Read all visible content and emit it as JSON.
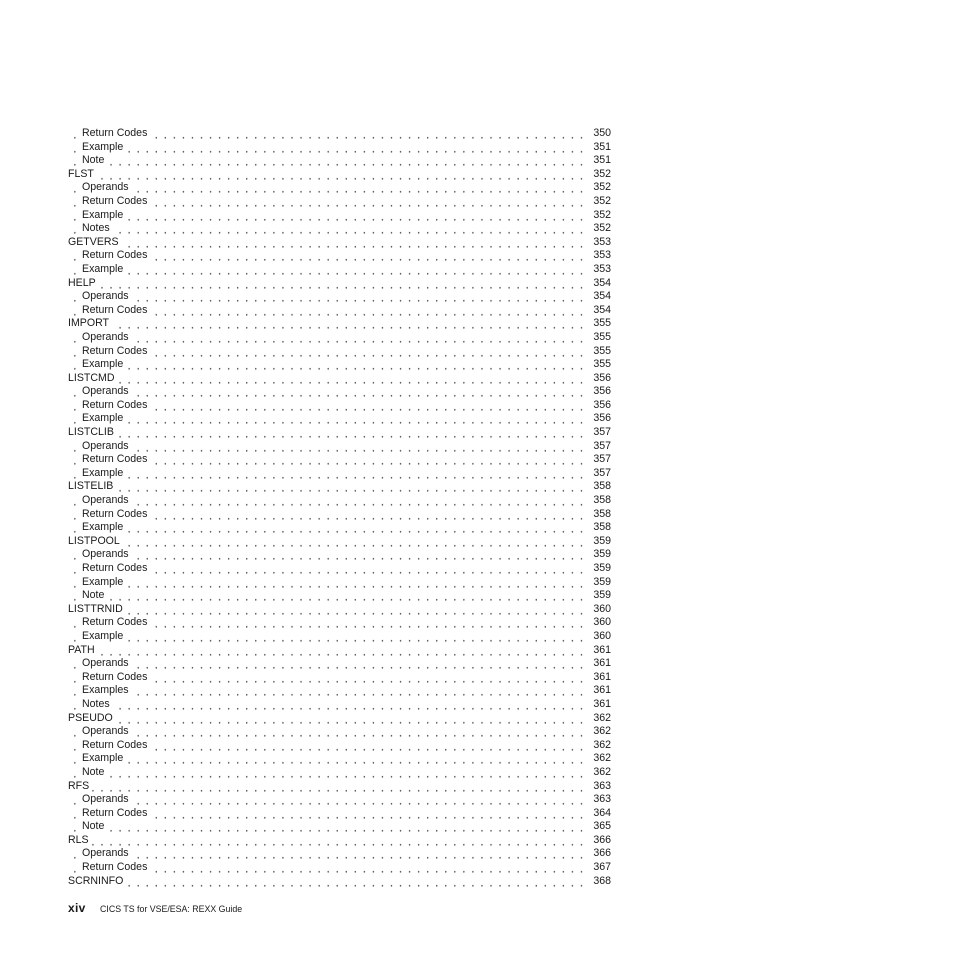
{
  "toc": {
    "entries": [
      {
        "title": "Return Codes",
        "level": 2,
        "page": "350"
      },
      {
        "title": "Example",
        "level": 2,
        "page": "351"
      },
      {
        "title": "Note",
        "level": 2,
        "page": "351"
      },
      {
        "title": "FLST",
        "level": 1,
        "page": "352"
      },
      {
        "title": "Operands",
        "level": 2,
        "page": "352"
      },
      {
        "title": "Return Codes",
        "level": 2,
        "page": "352"
      },
      {
        "title": "Example",
        "level": 2,
        "page": "352"
      },
      {
        "title": "Notes",
        "level": 2,
        "page": "352"
      },
      {
        "title": "GETVERS",
        "level": 1,
        "page": "353"
      },
      {
        "title": "Return Codes",
        "level": 2,
        "page": "353"
      },
      {
        "title": "Example",
        "level": 2,
        "page": "353"
      },
      {
        "title": "HELP",
        "level": 1,
        "page": "354"
      },
      {
        "title": "Operands",
        "level": 2,
        "page": "354"
      },
      {
        "title": "Return Codes",
        "level": 2,
        "page": "354"
      },
      {
        "title": "IMPORT",
        "level": 1,
        "page": "355"
      },
      {
        "title": "Operands",
        "level": 2,
        "page": "355"
      },
      {
        "title": "Return Codes",
        "level": 2,
        "page": "355"
      },
      {
        "title": "Example",
        "level": 2,
        "page": "355"
      },
      {
        "title": "LISTCMD",
        "level": 1,
        "page": "356"
      },
      {
        "title": "Operands",
        "level": 2,
        "page": "356"
      },
      {
        "title": "Return Codes",
        "level": 2,
        "page": "356"
      },
      {
        "title": "Example",
        "level": 2,
        "page": "356"
      },
      {
        "title": "LISTCLIB",
        "level": 1,
        "page": "357"
      },
      {
        "title": "Operands",
        "level": 2,
        "page": "357"
      },
      {
        "title": "Return Codes",
        "level": 2,
        "page": "357"
      },
      {
        "title": "Example",
        "level": 2,
        "page": "357"
      },
      {
        "title": "LISTELIB",
        "level": 1,
        "page": "358"
      },
      {
        "title": "Operands",
        "level": 2,
        "page": "358"
      },
      {
        "title": "Return Codes",
        "level": 2,
        "page": "358"
      },
      {
        "title": "Example",
        "level": 2,
        "page": "358"
      },
      {
        "title": "LISTPOOL",
        "level": 1,
        "page": "359"
      },
      {
        "title": "Operands",
        "level": 2,
        "page": "359"
      },
      {
        "title": "Return Codes",
        "level": 2,
        "page": "359"
      },
      {
        "title": "Example",
        "level": 2,
        "page": "359"
      },
      {
        "title": "Note",
        "level": 2,
        "page": "359"
      },
      {
        "title": "LISTTRNID",
        "level": 1,
        "page": "360"
      },
      {
        "title": "Return Codes",
        "level": 2,
        "page": "360"
      },
      {
        "title": "Example",
        "level": 2,
        "page": "360"
      },
      {
        "title": "PATH",
        "level": 1,
        "page": "361"
      },
      {
        "title": "Operands",
        "level": 2,
        "page": "361"
      },
      {
        "title": "Return Codes",
        "level": 2,
        "page": "361"
      },
      {
        "title": "Examples",
        "level": 2,
        "page": "361"
      },
      {
        "title": "Notes",
        "level": 2,
        "page": "361"
      },
      {
        "title": "PSEUDO",
        "level": 1,
        "page": "362"
      },
      {
        "title": "Operands",
        "level": 2,
        "page": "362"
      },
      {
        "title": "Return Codes",
        "level": 2,
        "page": "362"
      },
      {
        "title": "Example",
        "level": 2,
        "page": "362"
      },
      {
        "title": "Note",
        "level": 2,
        "page": "362"
      },
      {
        "title": "RFS",
        "level": 1,
        "page": "363"
      },
      {
        "title": "Operands",
        "level": 2,
        "page": "363"
      },
      {
        "title": "Return Codes",
        "level": 2,
        "page": "364"
      },
      {
        "title": "Note",
        "level": 2,
        "page": "365"
      },
      {
        "title": "RLS",
        "level": 1,
        "page": "366"
      },
      {
        "title": "Operands",
        "level": 2,
        "page": "366"
      },
      {
        "title": "Return Codes",
        "level": 2,
        "page": "367"
      },
      {
        "title": "SCRNINFO",
        "level": 1,
        "page": "368"
      }
    ]
  },
  "footer": {
    "folio": "xiv",
    "book_title": "CICS TS for VSE/ESA:  REXX Guide"
  }
}
